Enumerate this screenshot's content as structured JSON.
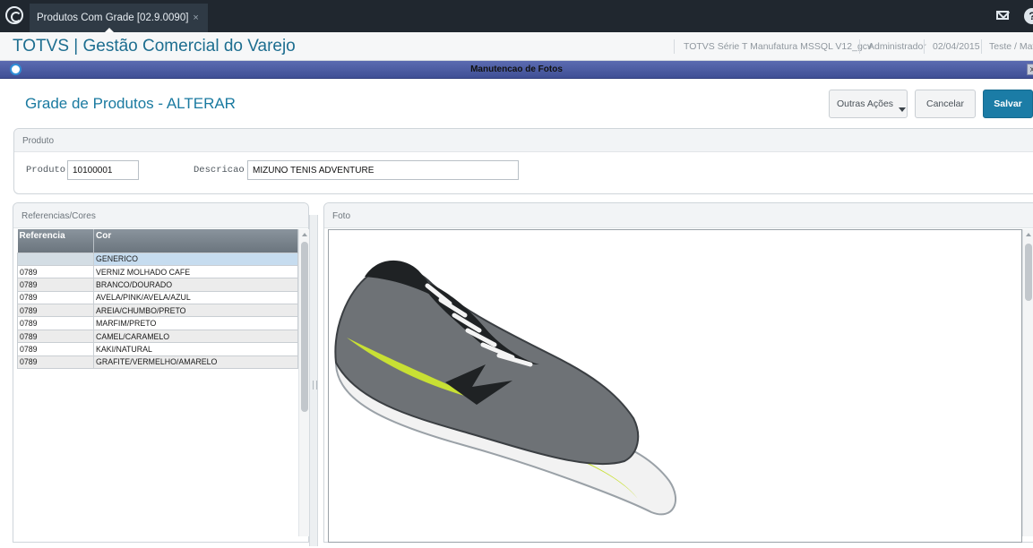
{
  "tabbar": {
    "tab_title": "Produtos Com Grade [02.9.0090]",
    "tab_close": "×",
    "logo_icon": "totvs-logo-icon",
    "mail_icon": "mail-icon",
    "help_icon_glyph": "?"
  },
  "header": {
    "app_title": "TOTVS | Gestão Comercial do Varejo",
    "environment": "TOTVS Série T Manufatura MSSQL V12_gcv",
    "user": "Administrador",
    "date": "02/04/2015",
    "branch": "Teste / Matri"
  },
  "dialog": {
    "title": "Manutencao de Fotos",
    "close_glyph": "x"
  },
  "form": {
    "title": "Grade de Produtos - ALTERAR",
    "buttons": {
      "more": "Outras Ações",
      "cancel": "Cancelar",
      "save": "Salvar"
    },
    "produto_group": {
      "title": "Produto",
      "produto_label": "Produto",
      "produto_value": "10100001",
      "descricao_label": "Descricao",
      "descricao_value": "MIZUNO TENIS ADVENTURE"
    }
  },
  "referencias": {
    "title": "Referencias/Cores",
    "columns": [
      "Referencia",
      "Cor"
    ],
    "rows": [
      [
        "",
        "GENERICO"
      ],
      [
        "0789",
        "VERNIZ MOLHADO CAFE"
      ],
      [
        "0789",
        "BRANCO/DOURADO"
      ],
      [
        "0789",
        "AVELA/PINK/AVELA/AZUL"
      ],
      [
        "0789",
        "AREIA/CHUMBO/PRETO"
      ],
      [
        "0789",
        "MARFIM/PRETO"
      ],
      [
        "0789",
        "CAMEL/CARAMELO"
      ],
      [
        "0789",
        "KAKI/NATURAL"
      ],
      [
        "0789",
        "GRAFITE/VERMELHO/AMARELO"
      ]
    ]
  },
  "foto": {
    "title": "Foto",
    "image": "running-shoe-photo",
    "colors": {
      "upper": "#6e7276",
      "accent": "#c8e034",
      "sole": "#f2f2f2",
      "dark": "#1f2224"
    }
  }
}
